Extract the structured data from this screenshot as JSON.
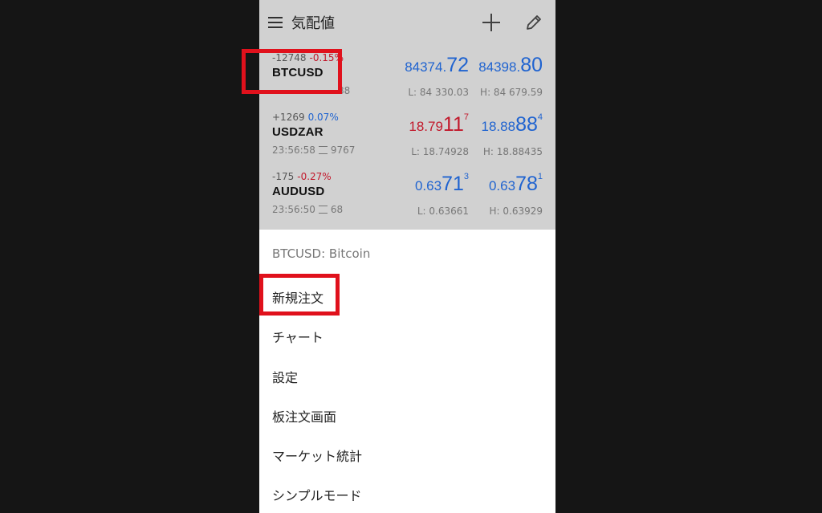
{
  "header": {
    "title": "気配値"
  },
  "quotes": [
    {
      "change": "-12748",
      "change_pct": "-0.15%",
      "symbol": "BTCUSD",
      "time": "",
      "spread": "88",
      "bid": {
        "big": "84374.",
        "pips": "72",
        "small": ""
      },
      "ask": {
        "big": "84398.",
        "pips": "80",
        "small": ""
      },
      "bid_color": "blue",
      "ask_color": "blue",
      "low": "L: 84 330.03",
      "high": "H: 84 679.59"
    },
    {
      "change": "+1269",
      "change_pct": "0.07%",
      "symbol": "USDZAR",
      "time": "23:56:58",
      "spread": "9767",
      "bid": {
        "big": "18.79",
        "pips": "11",
        "small": "7"
      },
      "ask": {
        "big": "18.88",
        "pips": "88",
        "small": "4"
      },
      "bid_color": "red",
      "ask_color": "blue",
      "low": "L: 18.74928",
      "high": "H: 18.88435"
    },
    {
      "change": "-175",
      "change_pct": "-0.27%",
      "symbol": "AUDUSD",
      "time": "23:56:50",
      "spread": "68",
      "bid": {
        "big": "0.63",
        "pips": "71",
        "small": "3"
      },
      "ask": {
        "big": "0.63",
        "pips": "78",
        "small": "1"
      },
      "bid_color": "blue",
      "ask_color": "blue",
      "low": "L: 0.63661",
      "high": "H: 0.63929"
    }
  ],
  "context_menu": {
    "title": "BTCUSD: Bitcoin",
    "items": [
      "新規注文",
      "チャート",
      "設定",
      "板注文画面",
      "マーケット統計",
      "シンプルモード"
    ]
  },
  "colors": {
    "blue": "#1f63d0",
    "red": "#c2182b",
    "highlight": "#e0111c"
  },
  "icons": [
    "menu-icon",
    "plus-icon",
    "pencil-icon",
    "spread-icon"
  ]
}
